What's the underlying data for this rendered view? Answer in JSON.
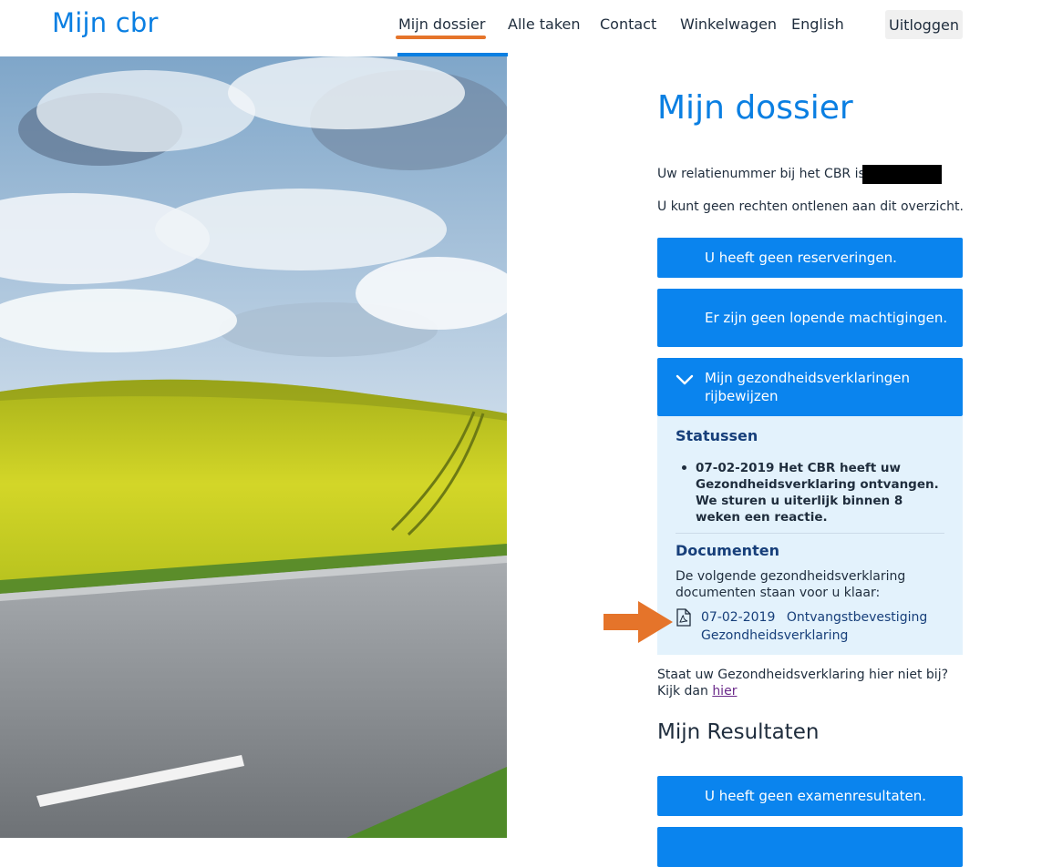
{
  "header": {
    "logo": "Mijn cbr",
    "nav": [
      "Mijn dossier",
      "Alle taken",
      "Contact",
      "Winkelwagen",
      "English"
    ],
    "logout": "Uitloggen"
  },
  "main": {
    "title": "Mijn dossier",
    "relatie_label": "Uw relatienummer bij het CBR is:",
    "disclaimer": "U kunt geen rechten ontlenen aan dit overzicht.",
    "reserveringen": "U heeft geen reserveringen.",
    "machtigingen": "Er zijn geen lopende machtigingen.",
    "gezondheid": {
      "title": "Mijn gezondheidsverklaringen rijbewijzen",
      "statussen_heading": "Statussen",
      "status_item": "07-02-2019 Het CBR heeft uw Gezondheidsverklaring ontvangen. We sturen u uiterlijk binnen 8 weken een reactie.",
      "documenten_heading": "Documenten",
      "documenten_intro": "De volgende gezondheidsverklaring documenten staan voor u klaar:",
      "doc_date": "07-02-2019",
      "doc_name": "Ontvangstbevestiging Gezondheidsverklaring"
    },
    "notfound_text": "Staat uw Gezondheidsverklaring hier niet bij? Kijk dan",
    "notfound_link": "hier",
    "results_title": "Mijn Resultaten",
    "examenresultaten": "U heeft geen examenresultaten."
  },
  "colors": {
    "brand_blue": "#0a84ee",
    "nav_underline": "#e5742a",
    "panel_bg": "#e3f2fc",
    "arrow": "#e5742a"
  },
  "icons": [
    "chevron-down-icon",
    "pdf-icon",
    "arrow-right-icon"
  ]
}
